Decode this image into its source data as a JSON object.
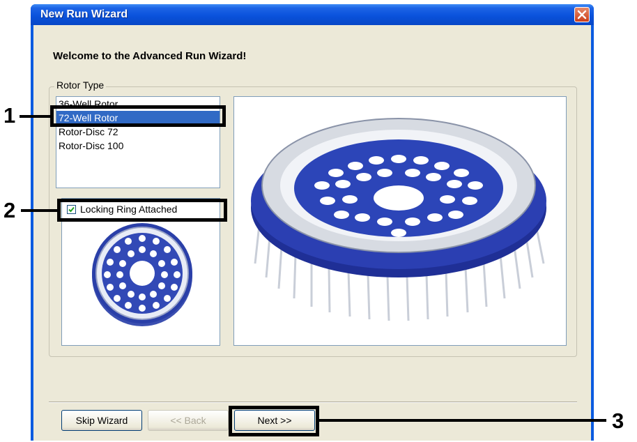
{
  "window": {
    "title": "New Run Wizard",
    "colors": {
      "titlebar": "#0a52dc",
      "face": "#ece9d8",
      "selection": "#316ac5"
    }
  },
  "wizard": {
    "welcome_text": "Welcome to the Advanced Run Wizard!",
    "rotor_group_label": "Rotor Type",
    "rotor_options": [
      {
        "label": "36-Well Rotor",
        "selected": false
      },
      {
        "label": "72-Well Rotor",
        "selected": true
      },
      {
        "label": "Rotor-Disc 72",
        "selected": false
      },
      {
        "label": "Rotor-Disc 100",
        "selected": false
      }
    ],
    "locking_ring": {
      "label": "Locking Ring Attached",
      "checked": true
    }
  },
  "buttons": {
    "skip": "Skip Wizard",
    "back": "<< Back",
    "next": "Next >>"
  },
  "callouts": [
    "1",
    "2",
    "3"
  ]
}
